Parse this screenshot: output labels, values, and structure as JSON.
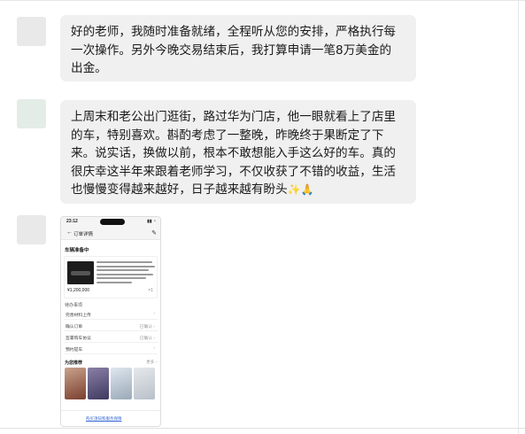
{
  "messages": [
    {
      "lines": [
        "好的老师，我随时准备就绪，全程听从您的安排，严格执行每",
        "一次操作。另外今晚交易结束后，我打算申请一笔8万美金的",
        "出金。"
      ]
    },
    {
      "lines": [
        "上周末和老公出门逛街，路过华为门店，他一眼就看上了店里",
        "的车，特别喜欢。斟酌考虑了一整晚，昨晚终于果断定了下",
        "来。说实话，换做以前，根本不敢想能入手这么好的车。真的",
        "很庆幸这半年来跟着老师学习，不仅收获了不错的收益，生活",
        "也慢慢变得越来越好，日子越来越有盼头"
      ],
      "emojis": [
        "✨",
        "🙏"
      ]
    }
  ],
  "phone": {
    "time": "23:12",
    "status_right": "▮▮ ◔",
    "nav_back": "←",
    "nav_title": "订单详情",
    "nav_edit": "✎",
    "section_title": "车辆准备中",
    "price": "¥1,200,000",
    "qty": "×1",
    "todo_title": "待办事项",
    "rows": [
      {
        "label": "完善材料上传",
        "value": "›"
      },
      {
        "label": "确认订单",
        "value": "已确认 ›"
      },
      {
        "label": "签署购车协议",
        "value": "已确认 ›"
      },
      {
        "label": "预约提车",
        "value": "›"
      }
    ],
    "rec_title": "为您推荐",
    "rec_more": "更多 ›",
    "footer_link": "购买须知和服务保障"
  }
}
